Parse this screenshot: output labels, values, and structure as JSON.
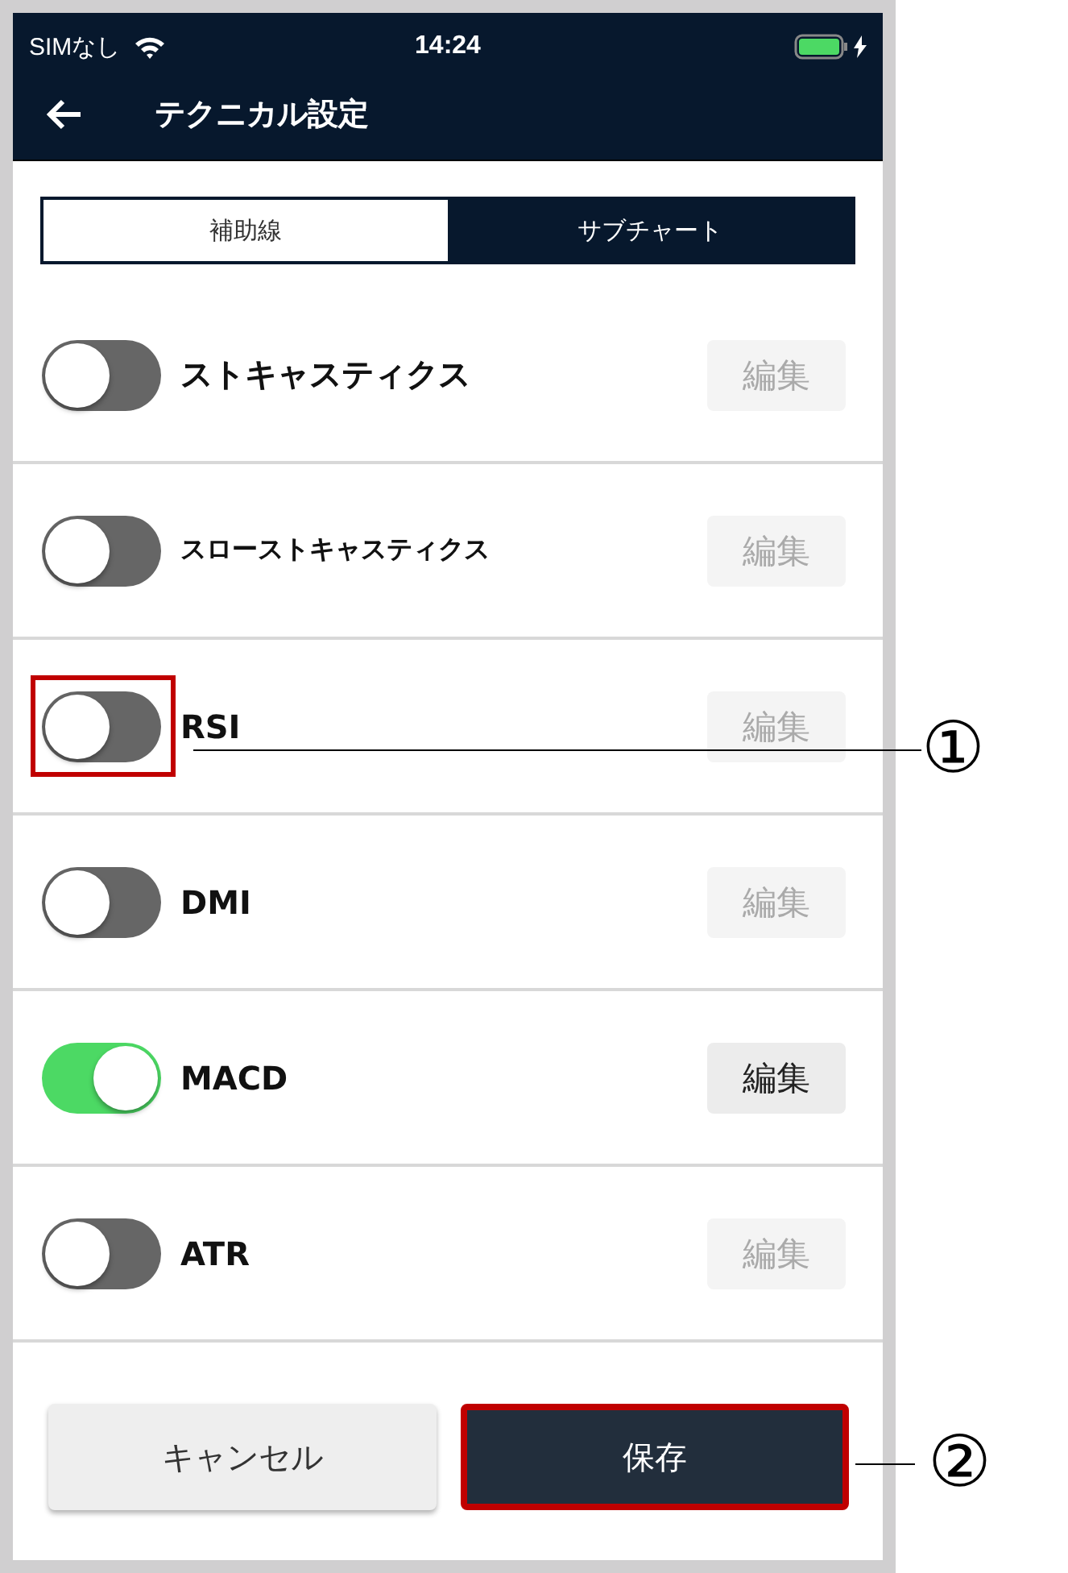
{
  "status_bar": {
    "carrier": "SIMなし",
    "time": "14:24",
    "charging": true
  },
  "header": {
    "back_icon": true,
    "title": "テクニカル設定"
  },
  "tabs": [
    {
      "label": "補助線",
      "selected": false
    },
    {
      "label": "サブチャート",
      "selected": true
    }
  ],
  "indicators": [
    {
      "name": "ストキャスティクス",
      "on": false,
      "edit_label": "編集",
      "edit_enabled": false,
      "highlighted": false,
      "kind": "standard"
    },
    {
      "name": "スローストキャスティクス",
      "on": false,
      "edit_label": "編集",
      "edit_enabled": false,
      "highlighted": false,
      "kind": "compact"
    },
    {
      "name": "RSI",
      "on": false,
      "edit_label": "編集",
      "edit_enabled": false,
      "highlighted": true,
      "kind": "standard"
    },
    {
      "name": "DMI",
      "on": false,
      "edit_label": "編集",
      "edit_enabled": false,
      "highlighted": false,
      "kind": "standard"
    },
    {
      "name": "MACD",
      "on": true,
      "edit_label": "編集",
      "edit_enabled": true,
      "highlighted": false,
      "kind": "standard"
    },
    {
      "name": "ATR",
      "on": false,
      "edit_label": "編集",
      "edit_enabled": false,
      "highlighted": false,
      "kind": "standard"
    }
  ],
  "buttons": [
    {
      "label": "キャンセル",
      "kind": "secondary",
      "highlighted": false
    },
    {
      "label": "保存",
      "kind": "primary",
      "highlighted": true
    }
  ],
  "callouts": [
    {
      "label": "①",
      "kind": "row"
    },
    {
      "label": "②",
      "kind": "button"
    }
  ]
}
